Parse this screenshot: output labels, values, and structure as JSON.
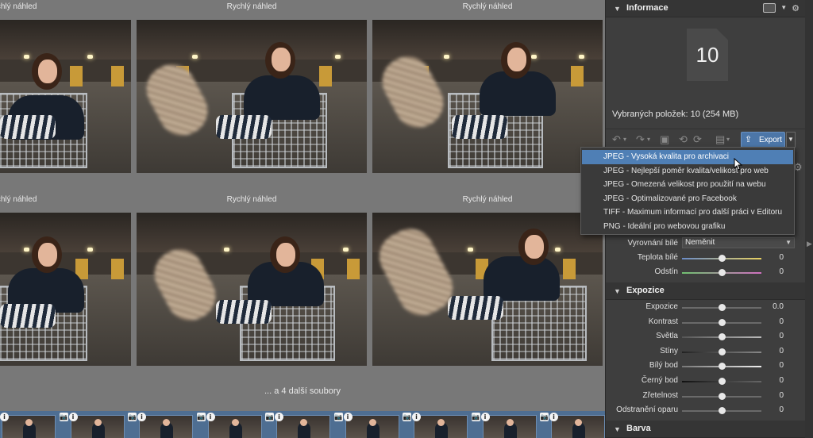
{
  "grid": {
    "captions": [
      "Rychlý náhled",
      "Rychlý náhled",
      "Rychlý náhled",
      "Rychlý náhled",
      "Rychlý náhled",
      "Rychlý náhled"
    ],
    "more_files": "... a 4 další soubory"
  },
  "filmstrip": {
    "badge_camera": "📷",
    "badge_info": "i",
    "count": 9
  },
  "panel": {
    "info": {
      "title": "Informace",
      "file_count": "10",
      "selected_text": "Vybraných položek: 10 (254 MB)"
    },
    "toolbar": {
      "export_label": "Export"
    },
    "white_balance": {
      "label": "Vyrovnání bílé",
      "value": "Neměnit",
      "sliders": [
        {
          "label": "Teplota bílé",
          "value": "0",
          "level": 0.5
        },
        {
          "label": "Odstín",
          "value": "0",
          "level": 0.5
        }
      ]
    },
    "exposure": {
      "title": "Expozice",
      "sliders": [
        {
          "label": "Expozice",
          "value": "0.0",
          "level": 0.5
        },
        {
          "label": "Kontrast",
          "value": "0",
          "level": 0.5
        },
        {
          "label": "Světla",
          "value": "0",
          "level": 0.5
        },
        {
          "label": "Stíny",
          "value": "0",
          "level": 0.5
        },
        {
          "label": "Bílý bod",
          "value": "0",
          "level": 0.5
        },
        {
          "label": "Černý bod",
          "value": "0",
          "level": 0.5
        },
        {
          "label": "Zřetelnost",
          "value": "0",
          "level": 0.5
        },
        {
          "label": "Odstranění oparu",
          "value": "0",
          "level": 0.5
        }
      ]
    },
    "color": {
      "title": "Barva"
    }
  },
  "export_menu": {
    "items": [
      "JPEG - Vysoká kvalita pro archivaci",
      "JPEG - Nejlepší poměr kvalita/velikost pro web",
      "JPEG - Omezená velikost pro použití na webu",
      "JPEG - Optimalizované pro Facebook",
      "TIFF - Maximum informací pro další práci v Editoru",
      "PNG - Ideální pro webovou grafiku"
    ],
    "active_index": 0
  },
  "colors": {
    "accent": "#4f7fb5",
    "panel_bg": "#3e3e3e",
    "grid_bg": "#787878",
    "filmstrip_bg": "#4e6e92"
  }
}
